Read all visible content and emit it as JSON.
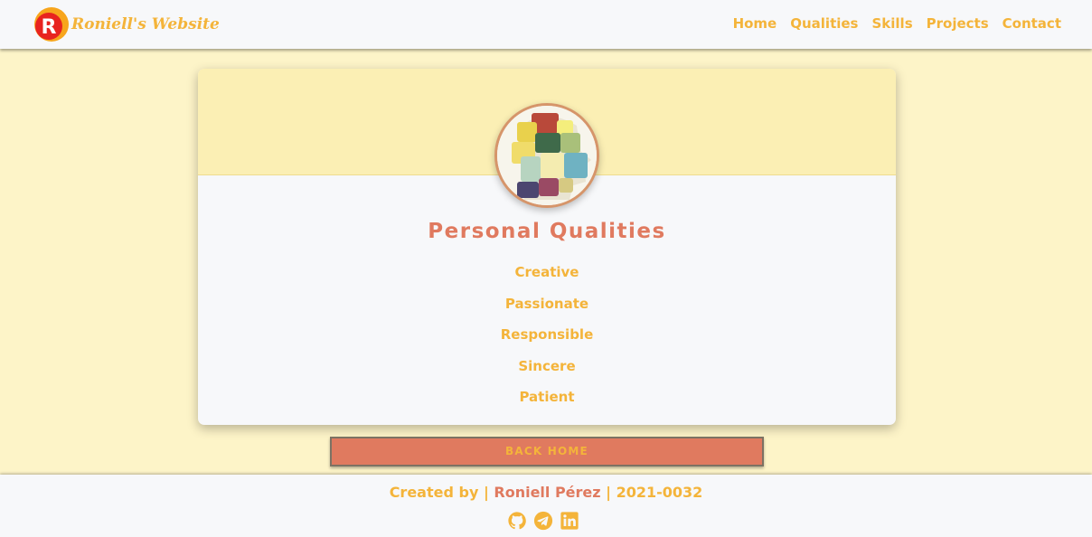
{
  "header": {
    "brand_letter": "R",
    "brand_name": "Roniell's Website",
    "nav": [
      {
        "label": "Home"
      },
      {
        "label": "Qualities"
      },
      {
        "label": "Skills"
      },
      {
        "label": "Projects"
      },
      {
        "label": "Contact"
      }
    ]
  },
  "card": {
    "avatar_icon": "puzzle-head-icon",
    "title": "Personal Qualities",
    "qualities": [
      "Creative",
      "Passionate",
      "Responsible",
      "Sincere",
      "Patient"
    ]
  },
  "back_button": {
    "label": "BACK HOME"
  },
  "footer": {
    "credit_label": "Created by",
    "separator": "|",
    "author": "Roniell Pérez",
    "id": "2021-0032",
    "socials": [
      {
        "icon": "github-icon"
      },
      {
        "icon": "telegram-icon"
      },
      {
        "icon": "linkedin-icon"
      }
    ]
  },
  "colors": {
    "accent": "#f4b43a",
    "coral": "#e07a5f",
    "background": "#fdf4c8",
    "banner": "#fbefb4",
    "surface": "#f7f8fa"
  }
}
